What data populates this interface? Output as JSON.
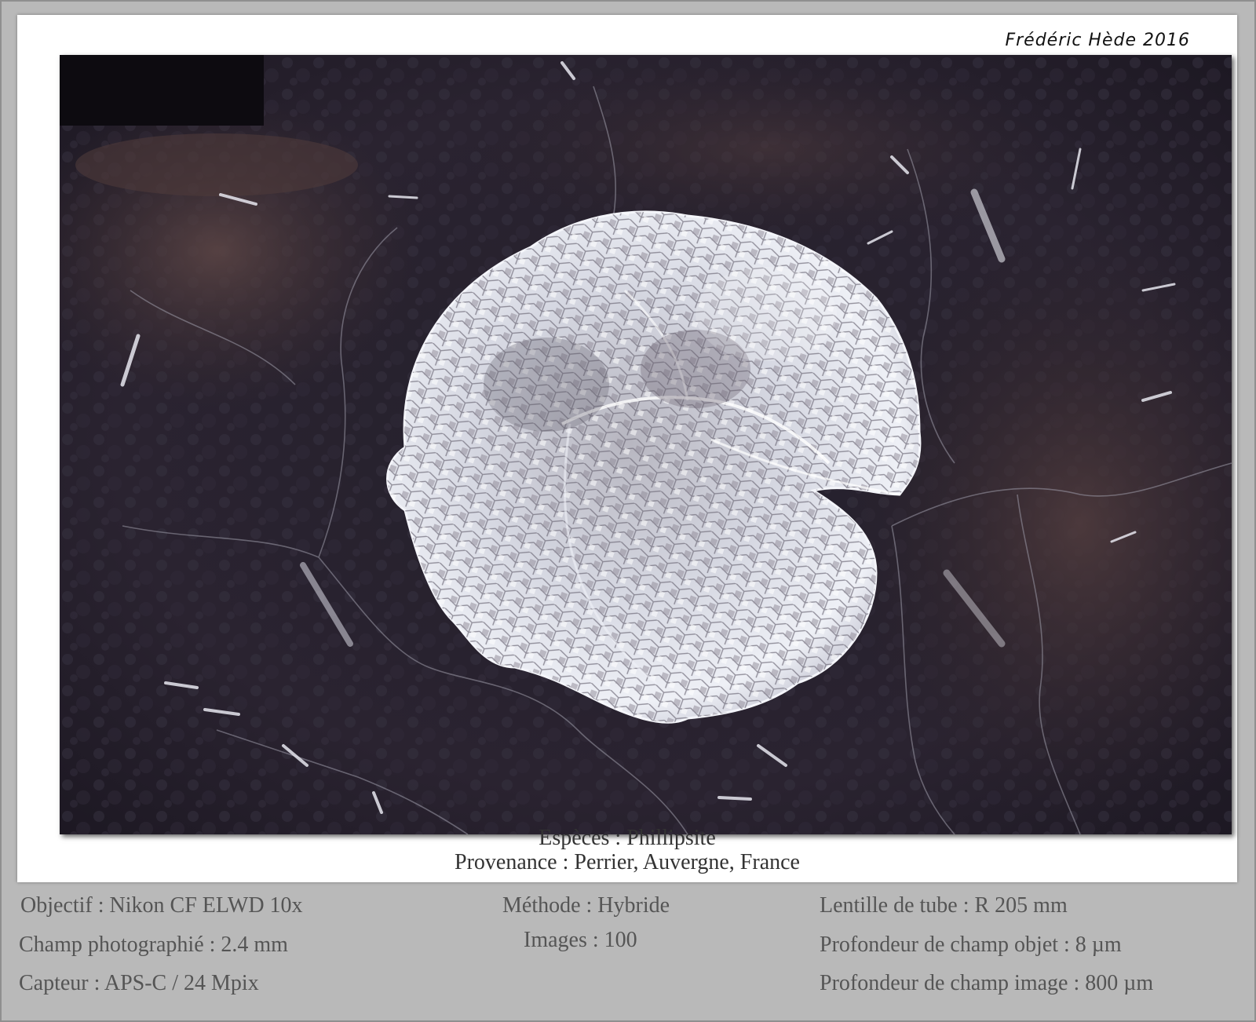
{
  "photo": {
    "signature": "Frédéric Hède 2016",
    "subject_icon": "phillipsite-crystal-cluster"
  },
  "caption": {
    "species": "Espèces : Phillipsite",
    "provenance": "Provenance : Perrier, Auvergne, France"
  },
  "details": {
    "left": [
      "Objectif : Nikon CF ELWD 10x",
      "Champ photographié : 2.4 mm",
      "Capteur : APS-C / 24 Mpix"
    ],
    "center": [
      "Méthode : Hybride",
      "Images : 100"
    ],
    "right": [
      "Lentille de tube : R 205 mm",
      "Profondeur de champ objet : 8 µm",
      "Profondeur de champ image : 800 µm"
    ]
  },
  "colors": {
    "page_background": "#b9b9b9",
    "card": "#ffffff",
    "matrix_dark": "#1d1a24",
    "matrix_brown": "#4a3a3c",
    "crystal": "#e6e8f0"
  }
}
